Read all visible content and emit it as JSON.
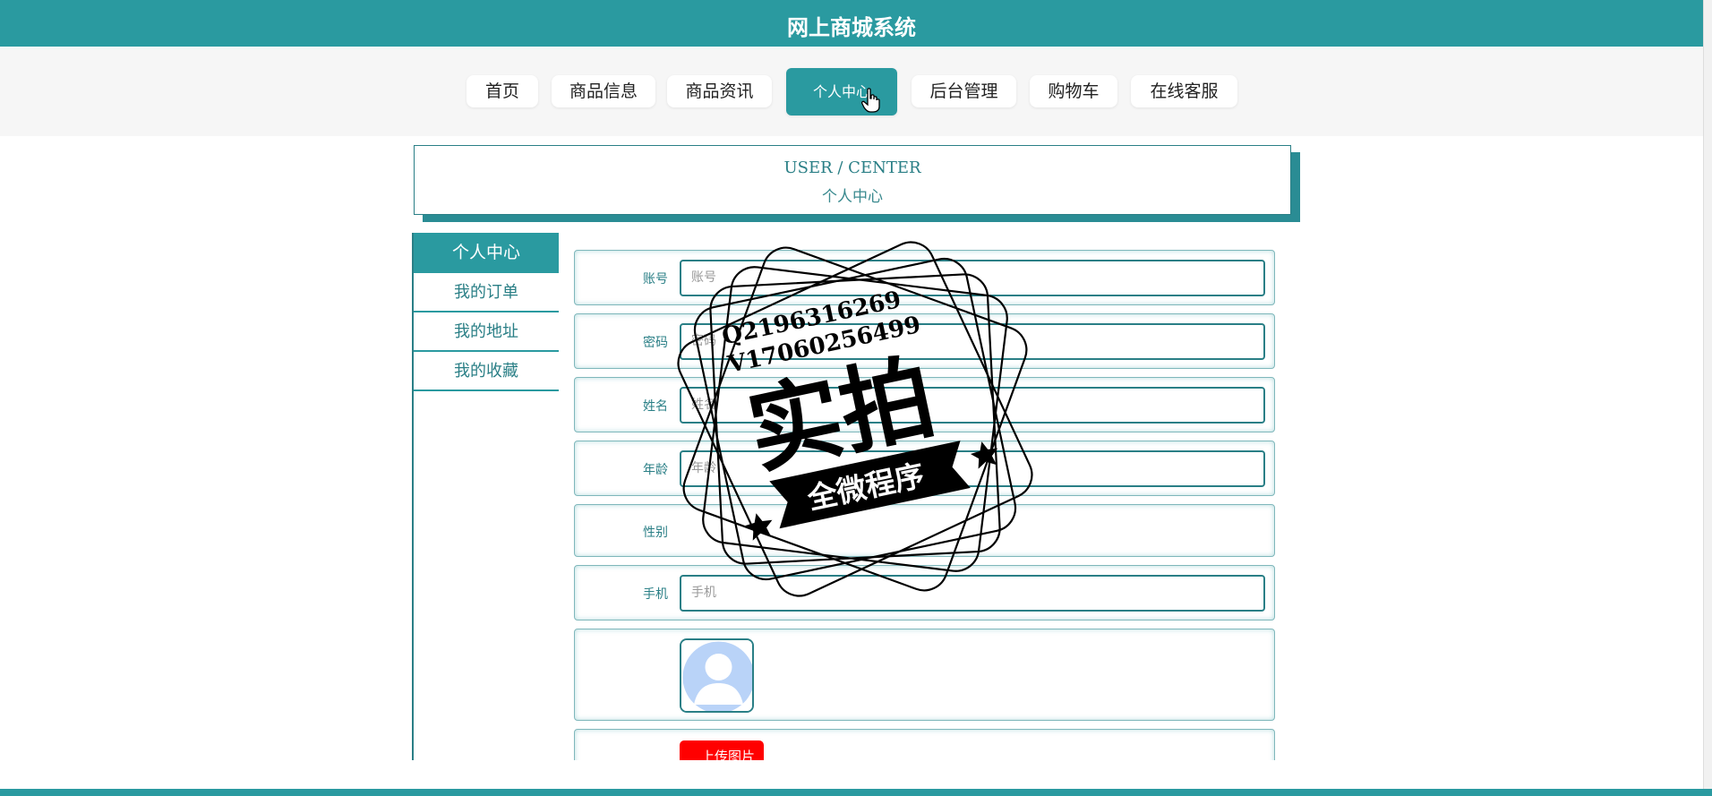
{
  "app": {
    "title": "网上商城系统"
  },
  "nav": {
    "items": [
      "首页",
      "商品信息",
      "商品资讯",
      "个人中心",
      "后台管理",
      "购物车",
      "在线客服"
    ],
    "active_index": 3
  },
  "banner": {
    "en": "USER / CENTER",
    "cn": "个人中心"
  },
  "sidebar": {
    "header": "个人中心",
    "items": [
      "我的订单",
      "我的地址",
      "我的收藏"
    ]
  },
  "form": {
    "account": {
      "label": "账号",
      "placeholder": "账号"
    },
    "password": {
      "label": "密码",
      "placeholder": "密码"
    },
    "name": {
      "label": "姓名",
      "placeholder": "姓名"
    },
    "age": {
      "label": "年龄",
      "placeholder": "年龄"
    },
    "gender": {
      "label": "性别"
    },
    "phone": {
      "label": "手机",
      "placeholder": "手机"
    },
    "upload_button": "上传图片"
  },
  "watermark": {
    "contact_q": "Q2196316269",
    "contact_v": "V17060256499",
    "main": "实拍",
    "ribbon": "全微程序"
  },
  "colors": {
    "accent": "#2a9aa0",
    "accent_dark": "#2a7f86",
    "upload": "#ff0000"
  }
}
